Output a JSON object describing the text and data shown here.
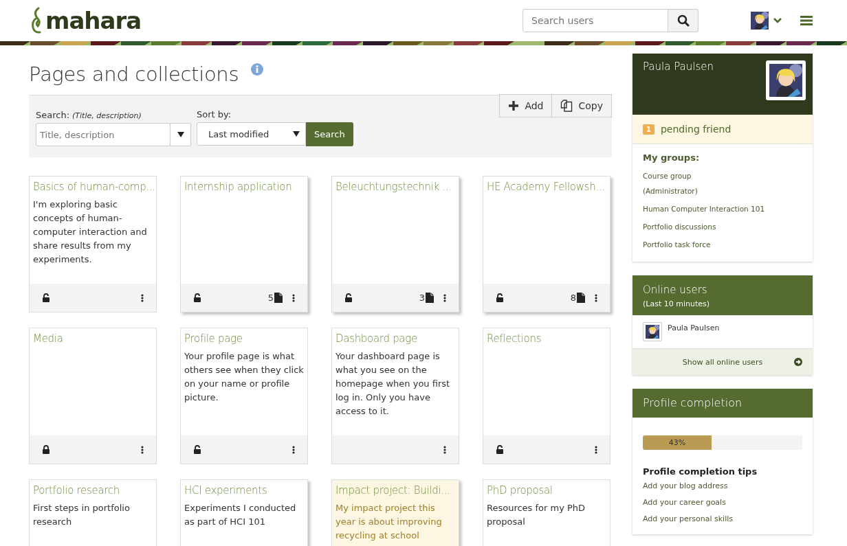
{
  "header": {
    "logo": "mahara",
    "search": {
      "placeholder": "Search users"
    }
  },
  "page": {
    "title": "Pages and collections"
  },
  "filter": {
    "search_label": "Search:",
    "search_hint": "(Title, description)",
    "search_field": {
      "placeholder": "Title, description"
    },
    "sort_label": "Sort by:",
    "sort_value": "Last modified",
    "search_button": "Search",
    "add_button": "Add",
    "copy_button": "Copy"
  },
  "cards": [
    {
      "kind": "page",
      "title": "Basics of human-comp...",
      "description": "I'm exploring basic concepts of human-computer interaction and share results from my experiments.",
      "locked": false,
      "highlighted": false
    },
    {
      "kind": "collection",
      "title": "Internship application",
      "locked": false,
      "count": "5",
      "highlighted": false
    },
    {
      "kind": "collection",
      "title": "Beleuchtungstechnik ...",
      "locked": false,
      "count": "3",
      "highlighted": false
    },
    {
      "kind": "collection",
      "title": "HE Academy Fellowsh...",
      "locked": false,
      "count": "8",
      "highlighted": false
    },
    {
      "kind": "page",
      "title": "Media",
      "locked": true,
      "highlighted": false
    },
    {
      "kind": "page",
      "title": "Profile page",
      "description": "Your profile page is what others see when they click on your name or profile picture.",
      "locked": false,
      "highlighted": false
    },
    {
      "kind": "page",
      "title": "Dashboard page",
      "description": "Your dashboard page is what you see on the homepage when you first log in. Only you have access to it.",
      "highlighted": false
    },
    {
      "kind": "page",
      "title": "Reflections",
      "locked": false,
      "highlighted": false
    },
    {
      "kind": "page",
      "title": "Portfolio research",
      "description": "First steps in portfolio research",
      "highlighted": false
    },
    {
      "kind": "collection",
      "title": "HCI experiments",
      "description": "Experiments I conducted as part of HCI 101",
      "highlighted": false
    },
    {
      "kind": "collection",
      "title": "Impact project: Buildi...",
      "description": "My impact project this year is about improving recycling at school",
      "highlighted": true
    },
    {
      "kind": "page",
      "title": "PhD proposal",
      "description": "Resources for my PhD proposal",
      "highlighted": false
    }
  ],
  "sidebar": {
    "profile": {
      "name": "Paula Paulsen",
      "pending_count": "1",
      "pending_label": "pending friend",
      "groups_heading": "My groups:",
      "groups": [
        "Course group (Administrator)",
        "Human Computer Interaction 101",
        "Portfolio discussions",
        "Portfolio task force"
      ]
    },
    "online": {
      "title": "Online users",
      "subtitle": "(Last 10 minutes)",
      "users": [
        "Paula Paulsen"
      ],
      "show_all": "Show all online users"
    },
    "completion": {
      "title": "Profile completion",
      "level": 0.43,
      "reading": "43%",
      "tips_heading": "Profile completion tips",
      "tips": [
        "Add your blog address",
        "Add your career goals",
        "Add your personal skills"
      ]
    }
  }
}
